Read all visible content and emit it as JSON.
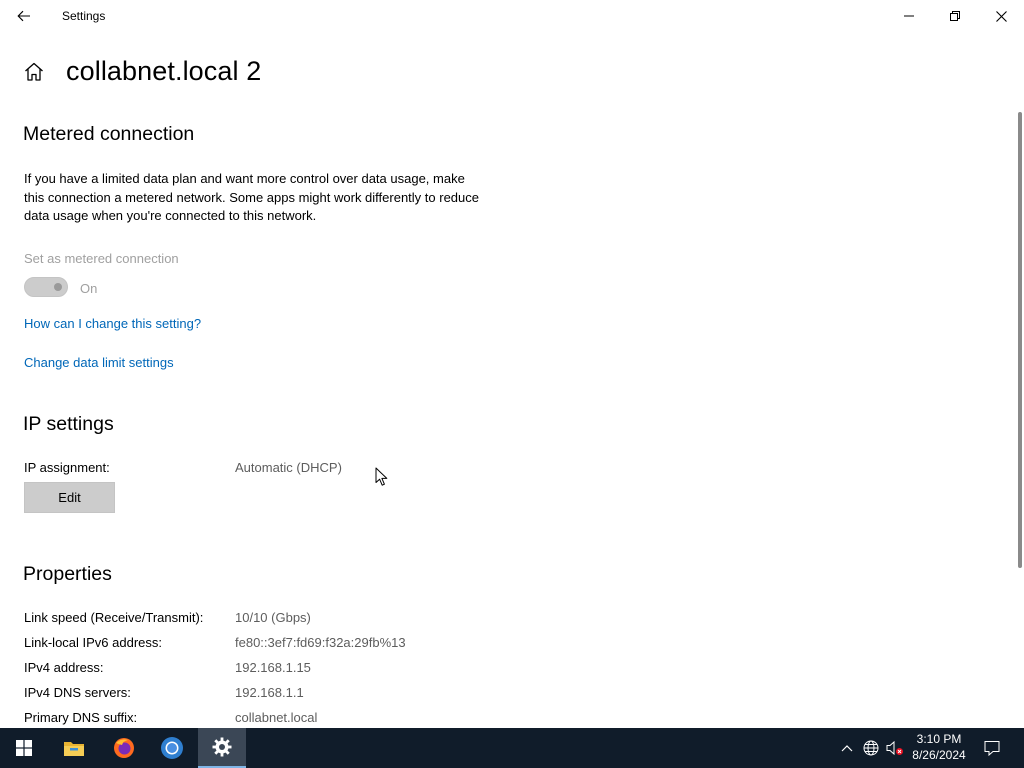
{
  "window": {
    "title": "Settings"
  },
  "header": {
    "title": "collabnet.local 2"
  },
  "metered": {
    "heading": "Metered connection",
    "description": "If you have a limited data plan and want more control over data usage, make this connection a metered network. Some apps might work differently to reduce data usage when you're connected to this network.",
    "toggle_label": "Set as metered connection",
    "toggle_state": "On",
    "link_help": "How can I change this setting?",
    "link_data_limit": "Change data limit settings"
  },
  "ip_settings": {
    "heading": "IP settings",
    "assignment_label": "IP assignment:",
    "assignment_value": "Automatic (DHCP)",
    "edit_label": "Edit"
  },
  "properties": {
    "heading": "Properties",
    "rows": [
      {
        "label": "Link speed (Receive/Transmit):",
        "value": "10/10 (Gbps)"
      },
      {
        "label": "Link-local IPv6 address:",
        "value": "fe80::3ef7:fd69:f32a:29fb%13"
      },
      {
        "label": "IPv4 address:",
        "value": "192.168.1.15"
      },
      {
        "label": "IPv4 DNS servers:",
        "value": "192.168.1.1"
      },
      {
        "label": "Primary DNS suffix:",
        "value": "collabnet.local"
      }
    ]
  },
  "taskbar": {
    "apps": [
      "windows-start-icon",
      "file-explorer-icon",
      "firefox-icon",
      "chrome-icon",
      "settings-gear-icon"
    ],
    "time": "3:10 PM",
    "date": "8/26/2024"
  },
  "colors": {
    "link": "#0067b8",
    "taskbar": "#101c2a",
    "disabled_text": "#a0a0a0"
  }
}
